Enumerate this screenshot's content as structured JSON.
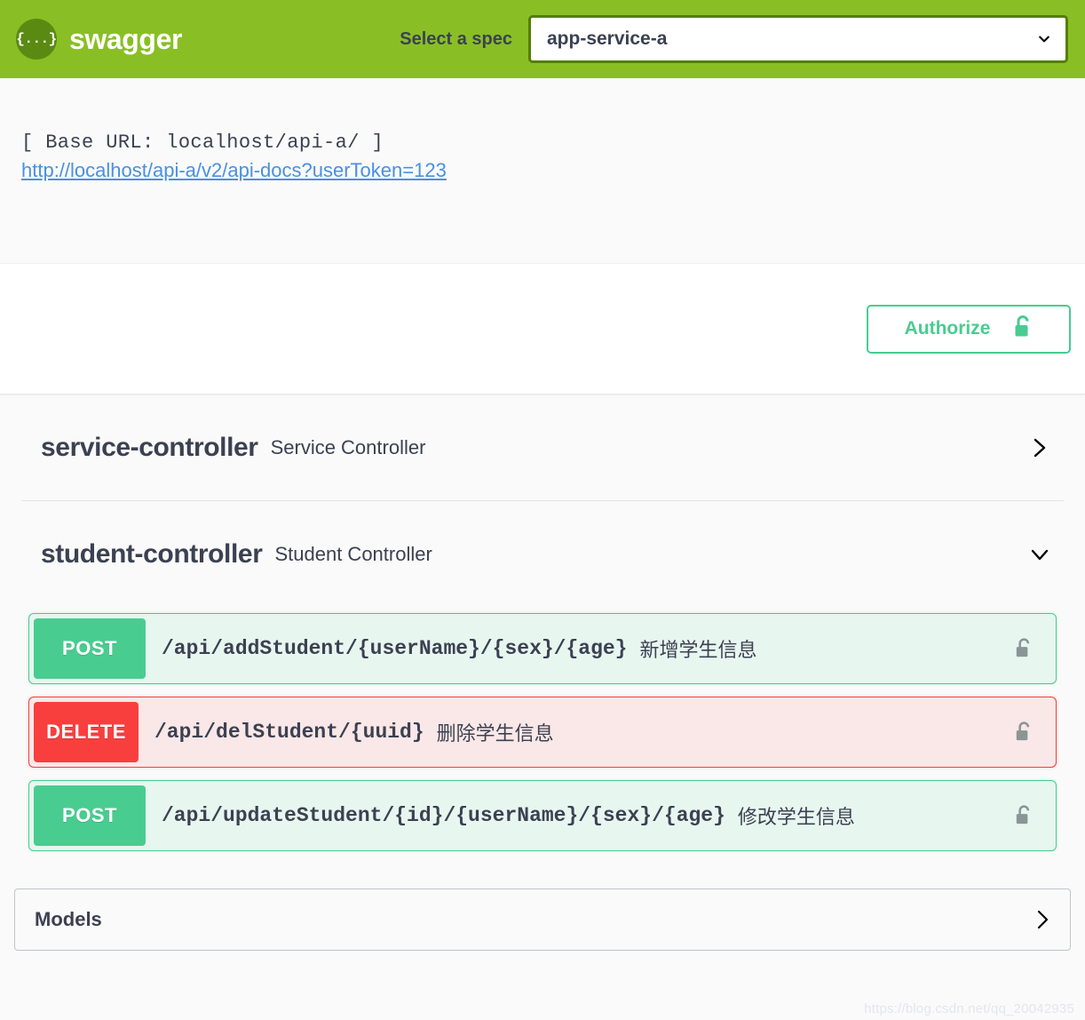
{
  "topbar": {
    "logo_mark": "{...}",
    "logo_text": "swagger",
    "select_label": "Select a spec",
    "selected_spec": "app-service-a",
    "chevron_icon": "chevron-down-icon",
    "bg_color": "#89bf24",
    "select_border_color": "#547f00"
  },
  "info": {
    "base_url": "[ Base URL: localhost/api-a/ ]",
    "docs_link": "http://localhost/api-a/v2/api-docs?userToken=123",
    "link_color": "#4990e2"
  },
  "auth": {
    "authorize_label": "Authorize",
    "lock_icon": "unlock-icon",
    "accent_color": "#49cc90"
  },
  "tags": [
    {
      "name": "service-controller",
      "description": "Service Controller",
      "expanded": false,
      "chevron_icon": "chevron-right-icon",
      "operations": []
    },
    {
      "name": "student-controller",
      "description": "Student Controller",
      "expanded": true,
      "chevron_icon": "chevron-down-icon",
      "operations": [
        {
          "method": "POST",
          "path": "/api/addStudent/{userName}/{sex}/{age}",
          "summary": "新增学生信息",
          "lock_icon": "unlock-icon",
          "color": "#49cc90"
        },
        {
          "method": "DELETE",
          "path": "/api/delStudent/{uuid}",
          "summary": "删除学生信息",
          "lock_icon": "unlock-icon",
          "color": "#f93e3e"
        },
        {
          "method": "POST",
          "path": "/api/updateStudent/{id}/{userName}/{sex}/{age}",
          "summary": "修改学生信息",
          "lock_icon": "unlock-icon",
          "color": "#49cc90"
        }
      ]
    }
  ],
  "models": {
    "title": "Models",
    "chevron_icon": "chevron-right-icon",
    "expanded": false
  },
  "watermark": {
    "text": "https://blog.csdn.net/qq_20042935"
  }
}
